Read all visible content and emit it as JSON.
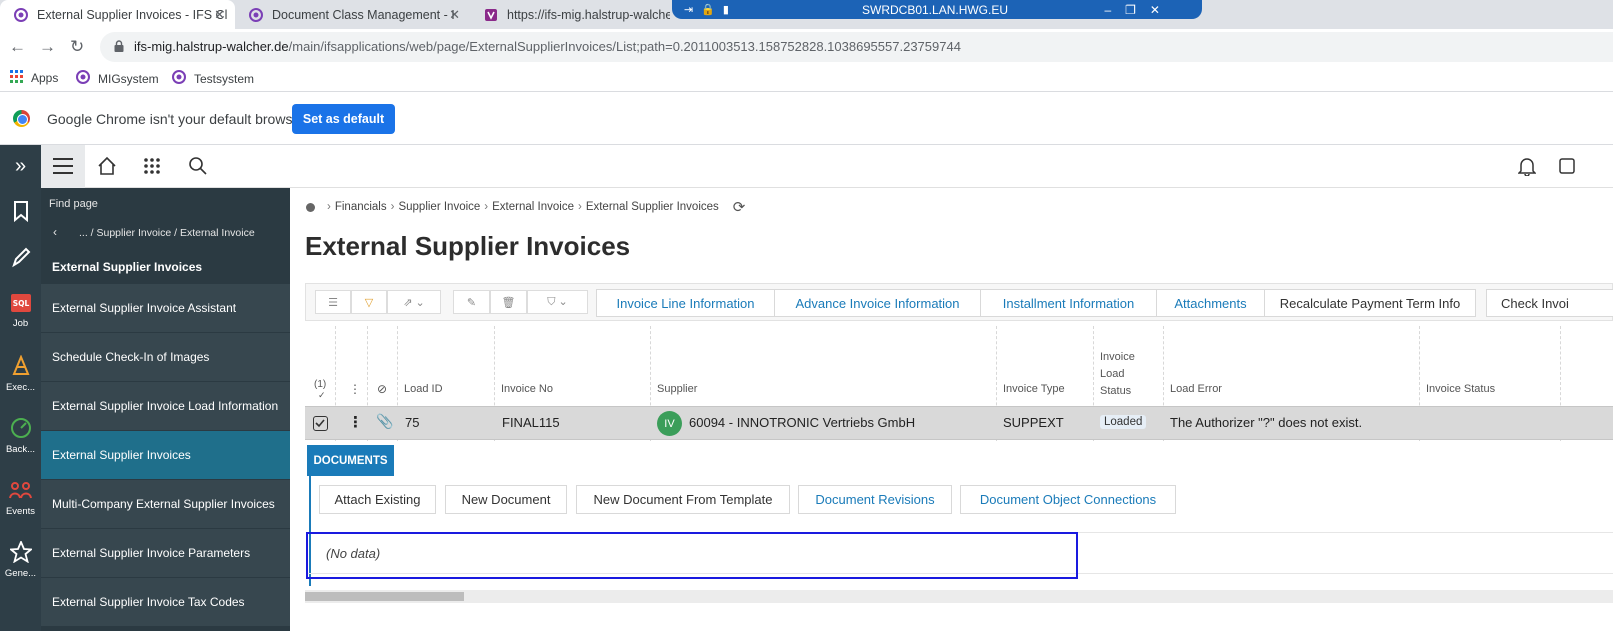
{
  "browser": {
    "tabs": [
      {
        "title": "External Supplier Invoices - IFS Cl",
        "active": true
      },
      {
        "title": "Document Class Management - I",
        "active": false
      },
      {
        "title": "https://ifs-mig.halstrup-walcher",
        "active": false
      }
    ],
    "remote_session_title": "SWRDCB01.LAN.HWG.EU",
    "url_host": "ifs-mig.halstrup-walcher.de",
    "url_path": "/main/ifsapplications/web/page/ExternalSupplierInvoices/List;path=0.2011003513.158752828.1038695557.23759744",
    "bookmarks": [
      "Apps",
      "MIGsystem",
      "Testsystem"
    ],
    "infobar": {
      "message": "Google Chrome isn't your default browser",
      "button": "Set as default"
    }
  },
  "rail": {
    "items": [
      {
        "icon": "expand-icon",
        "label": ""
      },
      {
        "icon": "bookmark-icon",
        "label": ""
      },
      {
        "icon": "pencil-icon",
        "label": ""
      },
      {
        "icon": "sql-icon",
        "label": "Job"
      },
      {
        "icon": "cone-icon",
        "label": "Exec..."
      },
      {
        "icon": "gauge-icon",
        "label": "Back..."
      },
      {
        "icon": "events-icon",
        "label": "Events"
      },
      {
        "icon": "star-icon",
        "label": "Gene..."
      }
    ]
  },
  "nav": {
    "find_page": "Find page",
    "breadcrumb": "... / Supplier Invoice / External Invoice",
    "section": "External Supplier Invoices",
    "items": [
      {
        "label": "External Supplier Invoice Assistant",
        "selected": false
      },
      {
        "label": "Schedule Check-In of Images",
        "selected": false
      },
      {
        "label": "External Supplier Invoice Load Information",
        "selected": false
      },
      {
        "label": "External Supplier Invoices",
        "selected": true
      },
      {
        "label": "Multi-Company External Supplier Invoices",
        "selected": false
      },
      {
        "label": "External Supplier Invoice Parameters",
        "selected": false
      },
      {
        "label": "External Supplier Invoice Tax Codes",
        "selected": false
      }
    ]
  },
  "main": {
    "breadcrumbs": [
      "Financials",
      "Supplier Invoice",
      "External Invoice",
      "External Supplier Invoices"
    ],
    "title": "External Supplier Invoices",
    "commands": [
      "Invoice Line Information",
      "Advance Invoice Information",
      "Installment Information",
      "Attachments",
      "Recalculate Payment Term Info",
      "Check Invoi"
    ],
    "grid": {
      "selection_count": "(1)",
      "columns": [
        "Load ID",
        "Invoice No",
        "Supplier",
        "Invoice Type",
        "Invoice Load Status",
        "Load Error",
        "Invoice Status"
      ],
      "invoice_load_status_lines": [
        "Invoice",
        "Load",
        "Status"
      ],
      "rows": [
        {
          "load_id": "75",
          "invoice_no": "FINAL115",
          "supplier_avatar": "IV",
          "supplier": "60094 - INNOTRONIC Vertriebs GmbH",
          "invoice_type": "SUPPEXT",
          "invoice_load_status": "Loaded",
          "load_error": "The Authorizer \"?\" does not exist.",
          "invoice_status": ""
        }
      ]
    },
    "documents": {
      "tab": "DOCUMENTS",
      "buttons": [
        "Attach Existing",
        "New Document",
        "New Document From Template",
        "Document Revisions",
        "Document Object Connections"
      ],
      "empty": "(No data)"
    }
  }
}
